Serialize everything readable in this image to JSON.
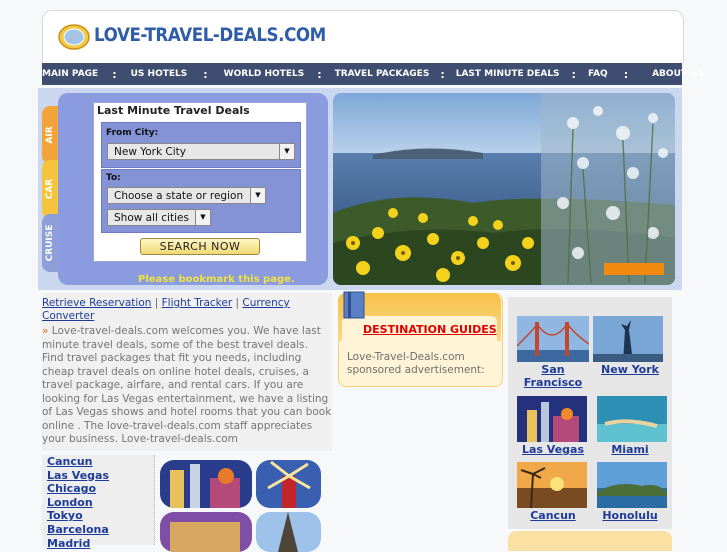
{
  "header": {
    "site_title": "LOVE-TRAVEL-DEALS.COM"
  },
  "nav": {
    "items": [
      "MAIN PAGE",
      "US HOTELS",
      "WORLD HOTELS",
      "TRAVEL PACKAGES",
      "LAST MINUTE DEALS",
      "FAQ",
      "ABOUT US"
    ],
    "separator": ":"
  },
  "hero": {
    "tabs": [
      "AIR",
      "CAR",
      "CRUISE"
    ],
    "search_title": "Last Minute Travel Deals",
    "from_label": "From City:",
    "from_value": "New York City",
    "to_label": "To:",
    "to_state_value": "Choose a state or region",
    "to_city_value": "Show all cities",
    "search_button": "SEARCH NOW",
    "bookmark_text": "Please bookmark this page."
  },
  "links": {
    "retrieve": "Retrieve Reservation",
    "divider": "|",
    "flight": "Flight Tracker",
    "currency": "Currency Converter"
  },
  "welcome": {
    "bullet": "»",
    "text": "Love-travel-deals.com welcomes you. We have last minute travel deals, some of the best travel deals. Find travel packages that fit you needs, including cheap travel deals on online hotel deals, cruises, a travel package, airfare, and rental cars. If you are looking for Las Vegas entertainment, we have a listing of Las Vegas shows and hotel rooms that you can book online . The love-travel-deals.com staff appreciates your business. Love-travel-deals.com"
  },
  "city_list": [
    "Cancun",
    "Las Vegas",
    "Chicago",
    "London",
    "Tokyo",
    "Barcelona",
    "Madrid"
  ],
  "destination": {
    "title": "DESTINATION GUIDES",
    "subtitle": "Love-Travel-Deals.com sponsored advertisement:"
  },
  "right_cities": [
    "San Francisco",
    "New York",
    "Las Vegas",
    "Miami",
    "Cancun",
    "Honolulu"
  ],
  "colors": {
    "nav_bg": "#3e4d70",
    "panel_blue": "#8b9be0",
    "link_blue": "#1d3c99",
    "dest_red": "#e00000",
    "orange": "#f8c24a"
  }
}
